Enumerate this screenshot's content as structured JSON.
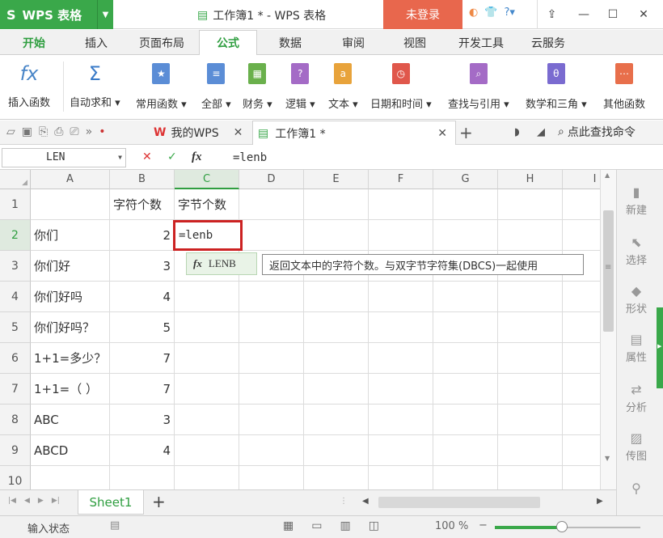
{
  "app": {
    "logo": "S",
    "name": "WPS 表格",
    "doc_title": "工作簿1 * - WPS 表格",
    "login": "未登录"
  },
  "menu_tabs": [
    "开始",
    "插入",
    "页面布局",
    "公式",
    "数据",
    "审阅",
    "视图",
    "开发工具",
    "云服务"
  ],
  "ribbon": {
    "insert_func": "插入函数",
    "buttons": [
      "自动求和",
      "常用函数",
      "全部",
      "财务",
      "逻辑",
      "文本",
      "日期和时间",
      "查找与引用",
      "数学和三角",
      "其他函数"
    ]
  },
  "doc_tabs": {
    "wps": "我的WPS",
    "book": "工作簿1 *",
    "search": "点此查找命令"
  },
  "formula": {
    "name_box": "LEN",
    "cancel": "✕",
    "confirm": "✓",
    "fx": "fx",
    "content": "=lenb"
  },
  "columns": [
    "A",
    "B",
    "C",
    "D",
    "E",
    "F",
    "G",
    "H",
    "I"
  ],
  "rows": [
    "1",
    "2",
    "3",
    "4",
    "5",
    "6",
    "7",
    "8",
    "9",
    "10"
  ],
  "cells": {
    "B1": "字符个数",
    "C1": "字节个数",
    "A2": "你们",
    "B2": "2",
    "A3": "你们好",
    "B3": "3",
    "A4": "你们好吗",
    "B4": "4",
    "A5": "你们好吗？",
    "B5": "5",
    "A6": "1+1=多少？",
    "B6": "7",
    "A7": "1+1=（  ）",
    "B7": "7",
    "A8": "ABC",
    "B8": "3",
    "A9": "ABCD",
    "B9": "4"
  },
  "edit": {
    "value": "=lenb",
    "autocomplete": "LENB",
    "tooltip": "返回文本中的字符个数。与双字节字符集(DBCS)一起使用"
  },
  "side_panel": [
    "新建",
    "选择",
    "形状",
    "属性",
    "分析",
    "传图"
  ],
  "sheet": {
    "name": "Sheet1",
    "add": "+"
  },
  "status": {
    "mode": "输入状态",
    "zoom": "100 %"
  },
  "colors": {
    "brand": "#3aa84a",
    "login_bg": "#e8674d",
    "highlight": "#cc2222"
  }
}
